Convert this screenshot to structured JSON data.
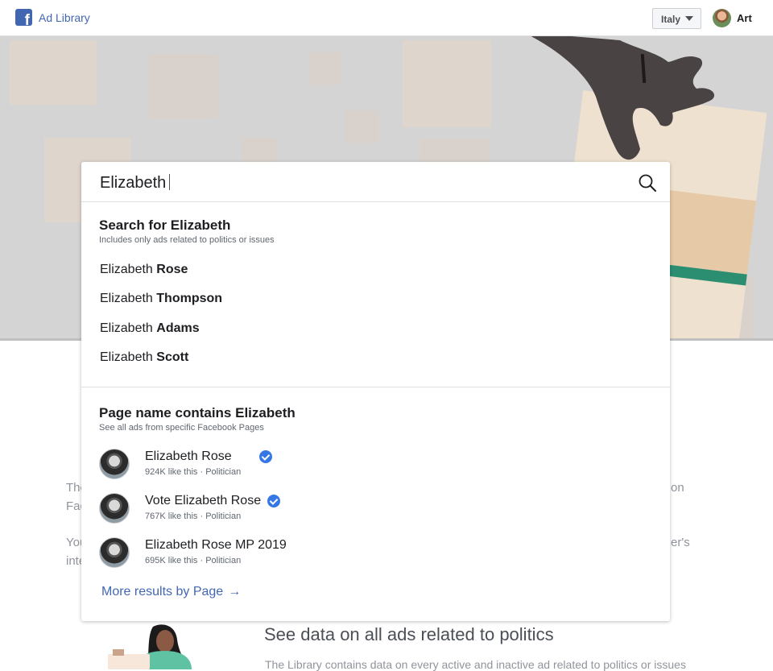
{
  "header": {
    "brand_label": "Ad Library",
    "country": "Italy",
    "user_name": "Art"
  },
  "background": {
    "text_left_1": "The",
    "text_left_2": "Fac",
    "text_left_3": "You",
    "text_left_4": "inte",
    "text_right_1": "on",
    "text_right_2": "er's",
    "section_title": "See data on all ads related to politics",
    "section_body": "The Library contains data on every active and inactive ad related to politics or issues"
  },
  "search": {
    "query": "Elizabeth",
    "search_group": {
      "title": "Search for Elizabeth",
      "subtitle": "Includes only ads related to politics or issues",
      "suggestions": [
        {
          "prefix": "Elizabeth ",
          "bold": "Rose"
        },
        {
          "prefix": "Elizabeth ",
          "bold": "Thompson"
        },
        {
          "prefix": "Elizabeth ",
          "bold": "Adams"
        },
        {
          "prefix": "Elizabeth ",
          "bold": "Scott"
        }
      ]
    },
    "page_group": {
      "title": "Page name contains Elizabeth",
      "subtitle": "See all ads from specific Facebook Pages",
      "pages": [
        {
          "name": "Elizabeth Rose",
          "meta": "924K like this · Politician",
          "verified": true
        },
        {
          "name": "Vote Elizabeth Rose",
          "meta": "767K like this · Politician",
          "verified": true
        },
        {
          "name": "Elizabeth Rose MP 2019",
          "meta": "695K like this · Politician",
          "verified": false
        }
      ],
      "more_label": "More results by Page",
      "more_arrow": "→"
    }
  },
  "colors": {
    "brand": "#4267b2",
    "verified": "#3578e5",
    "hero_bg": "#d4d4d4"
  },
  "icons": [
    "facebook-logo-icon",
    "chevron-down-icon",
    "search-icon",
    "verified-badge-icon",
    "arrow-right-icon"
  ]
}
